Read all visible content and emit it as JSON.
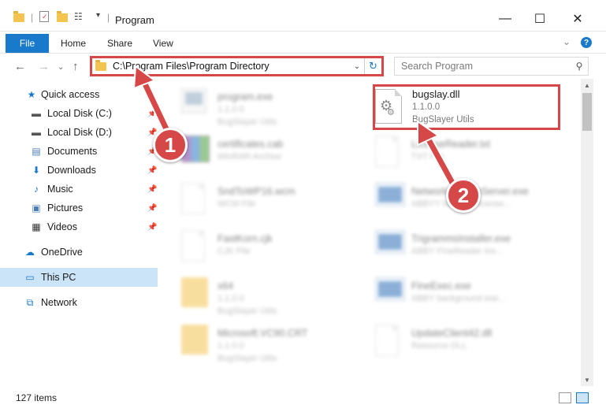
{
  "window": {
    "title": "Program",
    "minimize": "—",
    "maximize": "☐",
    "close": "✕"
  },
  "ribbon": {
    "tabs": [
      "File",
      "Home",
      "Share",
      "View"
    ],
    "help": "?",
    "collapse": "⌄"
  },
  "address": {
    "path": "C:\\Program Files\\Program Directory",
    "search_placeholder": "Search Program"
  },
  "sidebar": {
    "items": [
      {
        "label": "Quick access",
        "icon": "star-icon"
      },
      {
        "label": "Local Disk (C:)",
        "icon": "drive-icon"
      },
      {
        "label": "Local Disk (D:)",
        "icon": "drive-icon"
      },
      {
        "label": "Documents",
        "icon": "documents-icon"
      },
      {
        "label": "Downloads",
        "icon": "downloads-icon"
      },
      {
        "label": "Music",
        "icon": "music-icon"
      },
      {
        "label": "Pictures",
        "icon": "pictures-icon"
      },
      {
        "label": "Videos",
        "icon": "videos-icon"
      },
      {
        "label": "OneDrive",
        "icon": "cloud-icon"
      },
      {
        "label": "This PC",
        "icon": "computer-icon"
      },
      {
        "label": "Network",
        "icon": "network-icon"
      }
    ]
  },
  "files": {
    "highlighted": {
      "name": "bugslay.dll",
      "version": "1.1.0.0",
      "company": "BugSlayer Utils"
    },
    "left": [
      {
        "name": "program.exe",
        "meta1": "1.1.0.0",
        "meta2": "BugSlayer Utils"
      },
      {
        "name": "certificates.cab",
        "meta1": "WinRAR Archive",
        "meta2": ""
      },
      {
        "name": "SndToWP16.wcm",
        "meta1": "WCM File",
        "meta2": ""
      },
      {
        "name": "FastKorn.cjk",
        "meta1": "CJK File",
        "meta2": ""
      },
      {
        "name": "x64",
        "meta1": "1.1.0.0",
        "meta2": "BugSlayer Utils"
      },
      {
        "name": "Microsoft.VC90.CRT",
        "meta1": "1.1.0.0",
        "meta2": "BugSlayer Utils"
      }
    ],
    "right": [
      {
        "name": "LicenseReader.txt",
        "meta1": "TXT File",
        "meta2": ""
      },
      {
        "name": "NetworkLicenseServer.exe",
        "meta1": "ABBYY Network license...",
        "meta2": ""
      },
      {
        "name": "TrigrammsInstaller.exe",
        "meta1": "ABBY FineReader Ins...",
        "meta2": ""
      },
      {
        "name": "FineExec.exe",
        "meta1": "ABBY background exe...",
        "meta2": ""
      },
      {
        "name": "UpdateClient42.dll",
        "meta1": "Resource DLL",
        "meta2": ""
      }
    ]
  },
  "status": {
    "items": "127 items"
  },
  "callouts": {
    "one": "1",
    "two": "2"
  },
  "colors": {
    "accent": "#1979ca",
    "highlight": "#d64848",
    "selected": "#cce4f7"
  }
}
